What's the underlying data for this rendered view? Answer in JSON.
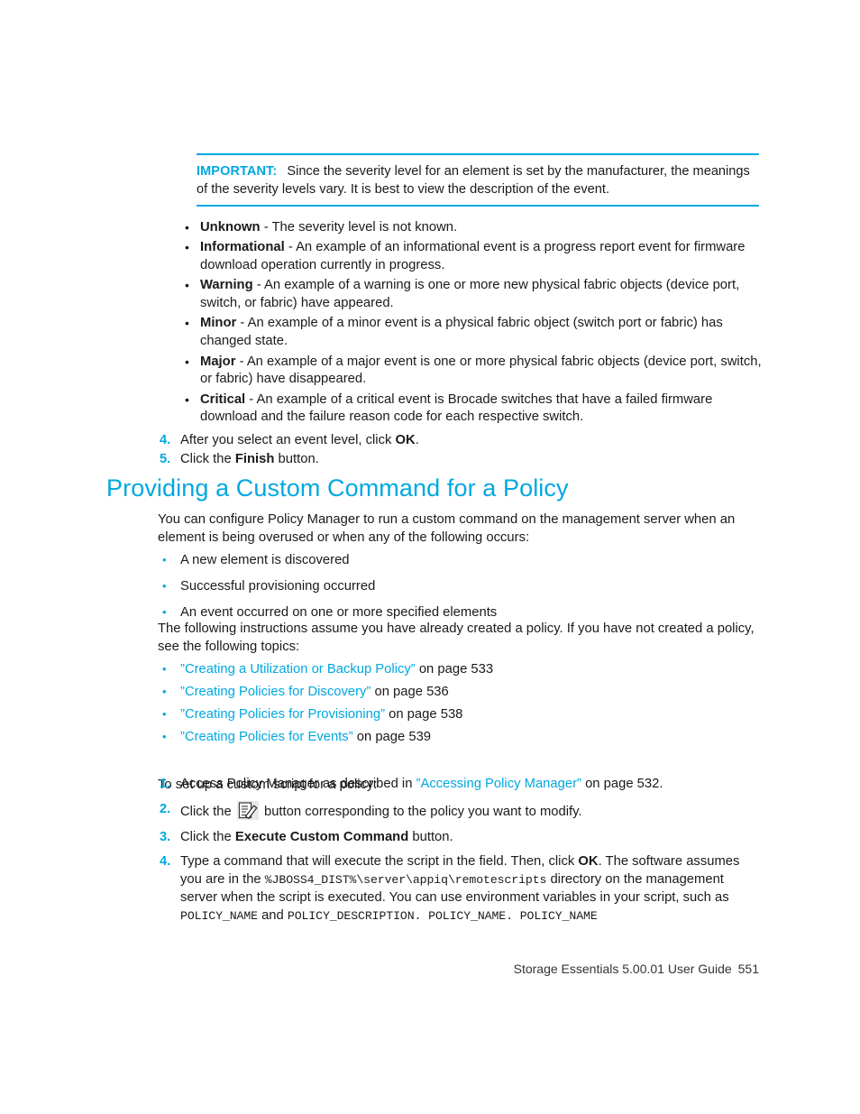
{
  "admonition": {
    "label": "IMPORTANT:",
    "text": "Since the severity level for an element is set by the manufacturer, the meanings of the severity levels vary. It is best to view the description of the event.",
    "rule_color": "#00a8e0",
    "label_color": "#00a8e0"
  },
  "severity_levels": [
    {
      "term": "Unknown",
      "description": "- The severity level is not known."
    },
    {
      "term": "Informational",
      "description": "- An example of an informational event is a progress report event for firmware download operation currently in progress."
    },
    {
      "term": "Warning",
      "description": "- An example of a warning is one or more new physical fabric objects (device port, switch, or fabric) have appeared."
    },
    {
      "term": "Minor",
      "description": "- An example of a minor event is a physical fabric object (switch port or fabric) has changed state."
    },
    {
      "term": "Major",
      "description": "- An example of a major event is one or more physical fabric objects (device port, switch, or fabric) have disappeared."
    },
    {
      "term": "Critical",
      "description": "- An example of a critical event is Brocade switches that have a failed firmware download and the failure reason code for each respective switch."
    }
  ],
  "event_steps": [
    {
      "num": "4.",
      "pre": "After you select an event level, click ",
      "bold": "OK",
      "post": "."
    },
    {
      "num": "5.",
      "pre": "Click the ",
      "bold": "Finish",
      "post": " button."
    }
  ],
  "heading": "Providing a Custom Command for a Policy",
  "intro_paragraph": "You can configure Policy Manager to run a custom command on the management server when an element is being overused or when any of the following occurs:",
  "occurs_list": [
    "A new element is discovered",
    "Successful provisioning occurred",
    "An event occurred on one or more specified elements"
  ],
  "assume_paragraph": "The following instructions assume you have already created a policy. If you have not created a policy, see the following topics:",
  "topics_list": [
    {
      "open_quote": "”",
      "link": "Creating a Utilization or Backup Policy",
      "close_quote": "”",
      "page_ref": " on page 533"
    },
    {
      "open_quote": "”",
      "link": "Creating Policies for Discovery",
      "close_quote": "”",
      "page_ref": " on page 536"
    },
    {
      "open_quote": "”",
      "link": "Creating Policies for Provisioning",
      "close_quote": "”",
      "page_ref": " on page 538"
    },
    {
      "open_quote": "”",
      "link": "Creating Policies for Events",
      "close_quote": "”",
      "page_ref": " on page 539"
    }
  ],
  "setup_paragraph": "To set up a custom script for a policy:",
  "script_steps": {
    "step1": {
      "num": "1.",
      "pre": "Access Policy Manager as described in ",
      "open_quote": "”",
      "link": "Accessing Policy Manager",
      "close_quote": "”",
      "post": " on page 532."
    },
    "step2": {
      "num": "2.",
      "pre": "Click the ",
      "icon": "edit-icon",
      "post": " button corresponding to the policy you want to modify."
    },
    "step3": {
      "num": "3.",
      "pre": "Click the ",
      "bold": "Execute Custom Command",
      "post": " button."
    },
    "step4": {
      "num": "4.",
      "seg1": "Type a command that will execute the script in the field. Then, click ",
      "bold1": "OK",
      "seg2": ". The software assumes you are in the ",
      "code1": "%JBOSS4_DIST%\\server\\appiq\\remotescripts",
      "seg3": " directory on the management server when the script is executed. You can use environment variables in your script, such as ",
      "code2": "POLICY_NAME",
      "seg4": " and ",
      "code3": "POLICY_DESCRIPTION. POLICY_NAME. POLICY_NAME"
    }
  },
  "footer": {
    "guide_title": "Storage Essentials 5.00.01 User Guide",
    "page_number": "551"
  }
}
